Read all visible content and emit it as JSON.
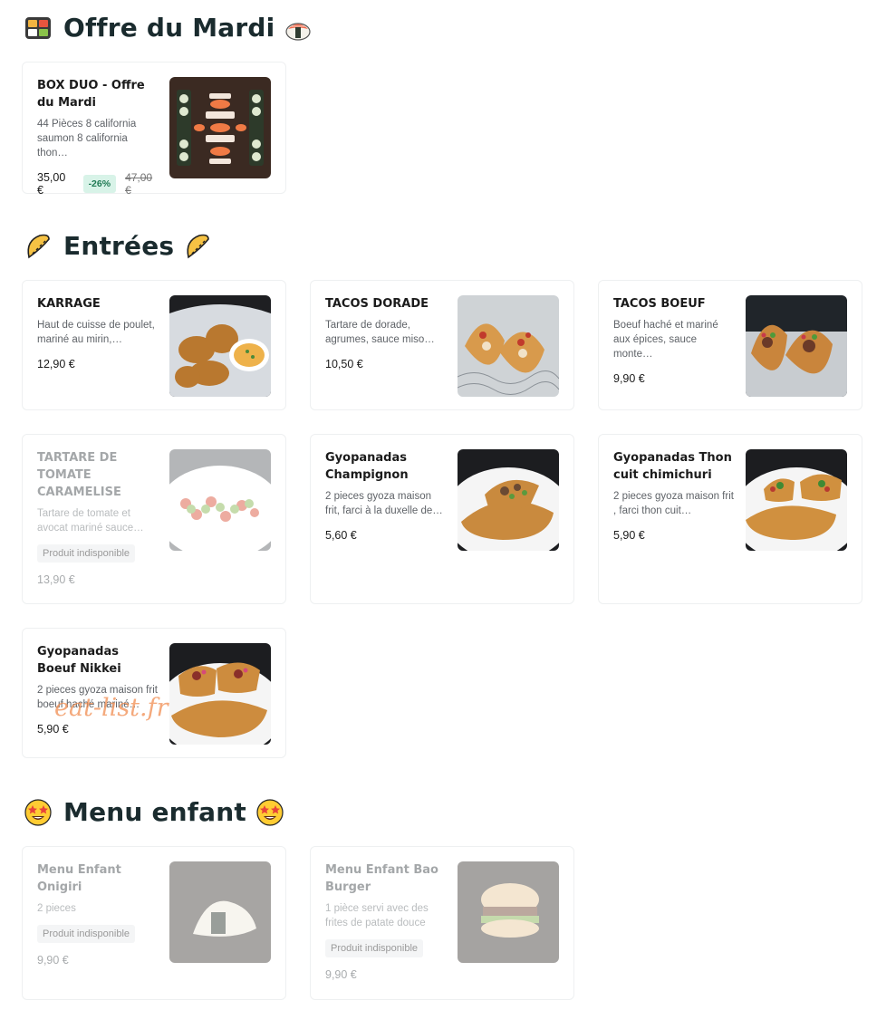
{
  "sections": [
    {
      "title": "Offre du Mardi",
      "emoji_left": "bento-box-icon",
      "emoji_right": "sushi-icon"
    },
    {
      "title": "Entrées",
      "emoji_left": "empanada-icon",
      "emoji_right": "empanada-icon"
    },
    {
      "title": "Menu enfant",
      "emoji_left": "star-struck-face-icon",
      "emoji_right": "star-struck-face-icon"
    }
  ],
  "items": [
    {
      "name": "BOX DUO - Offre du Mardi",
      "desc": "44 Pièces 8 california saumon 8 california thon…",
      "price": "35,00 €",
      "discount": "-26%",
      "old_price": "47,00 €",
      "available": true,
      "image": "sushi-box-photo"
    },
    {
      "name": "KARRAGE",
      "desc": "Haut de cuisse de poulet, mariné au mirin,…",
      "price": "12,90 €",
      "available": true,
      "image": "fried-chicken-photo"
    },
    {
      "name": "TACOS DORADE",
      "desc": "Tartare de dorade, agrumes, sauce miso…",
      "price": "10,50 €",
      "available": true,
      "image": "fish-tacos-photo"
    },
    {
      "name": "TACOS BOEUF",
      "desc": "Boeuf haché et mariné aux épices, sauce monte…",
      "price": "9,90 €",
      "available": true,
      "image": "beef-tacos-photo"
    },
    {
      "name": "TARTARE DE TOMATE CARAMELISE",
      "desc": "Tartare de tomate et avocat mariné sauce…",
      "price": "13,90 €",
      "available": false,
      "unavailable_label": "Produit indisponible",
      "image": "tomato-tartare-photo"
    },
    {
      "name": "Gyopanadas Champignon",
      "desc": "2 pieces gyoza maison frit, farci à la duxelle de…",
      "price": "5,60 €",
      "available": true,
      "image": "gyopanada-mushroom-photo"
    },
    {
      "name": "Gyopanadas Thon cuit chimichuri",
      "desc": "2 pieces gyoza maison frit , farci thon cuit…",
      "price": "5,90 €",
      "available": true,
      "image": "gyopanada-tuna-photo"
    },
    {
      "name": "Gyopanadas Boeuf Nikkei",
      "desc": "2 pieces gyoza maison frit boeuf haché mariné…",
      "price": "5,90 €",
      "available": true,
      "image": "gyopanada-beef-photo"
    },
    {
      "name": "Menu Enfant Onigiri",
      "desc": "2 pieces",
      "price": "9,90 €",
      "available": false,
      "unavailable_label": "Produit indisponible",
      "image": "onigiri-photo"
    },
    {
      "name": "Menu Enfant Bao Burger",
      "desc": "1 pièce servi avec des frites de patate douce",
      "price": "9,90 €",
      "available": false,
      "unavailable_label": "Produit indisponible",
      "image": "bao-burger-photo"
    }
  ],
  "watermark": "eat-list.fr"
}
